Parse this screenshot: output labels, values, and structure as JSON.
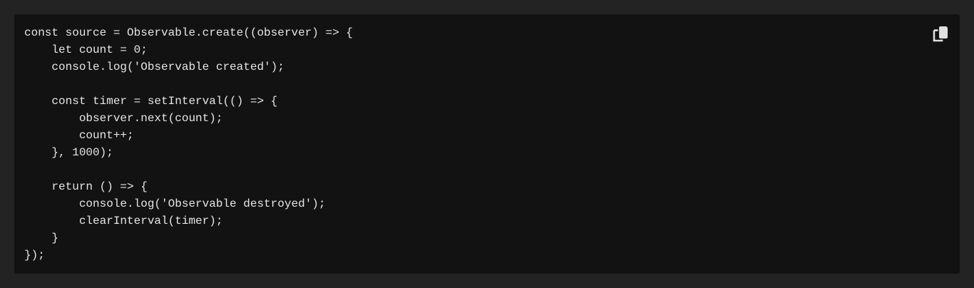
{
  "code": {
    "lines": [
      "const source = Observable.create((observer) => {",
      "    let count = 0;",
      "    console.log('Observable created');",
      "",
      "    const timer = setInterval(() => {",
      "        observer.next(count);",
      "        count++;",
      "    }, 1000);",
      "",
      "    return () => {",
      "        console.log('Observable destroyed');",
      "        clearInterval(timer);",
      "    }",
      "});"
    ]
  },
  "toolbar": {
    "copy_icon": "copy-icon"
  },
  "colors": {
    "page_background": "#232323",
    "code_background": "#121212",
    "code_text": "#e6e6e6",
    "icon": "#e0e0e0"
  }
}
